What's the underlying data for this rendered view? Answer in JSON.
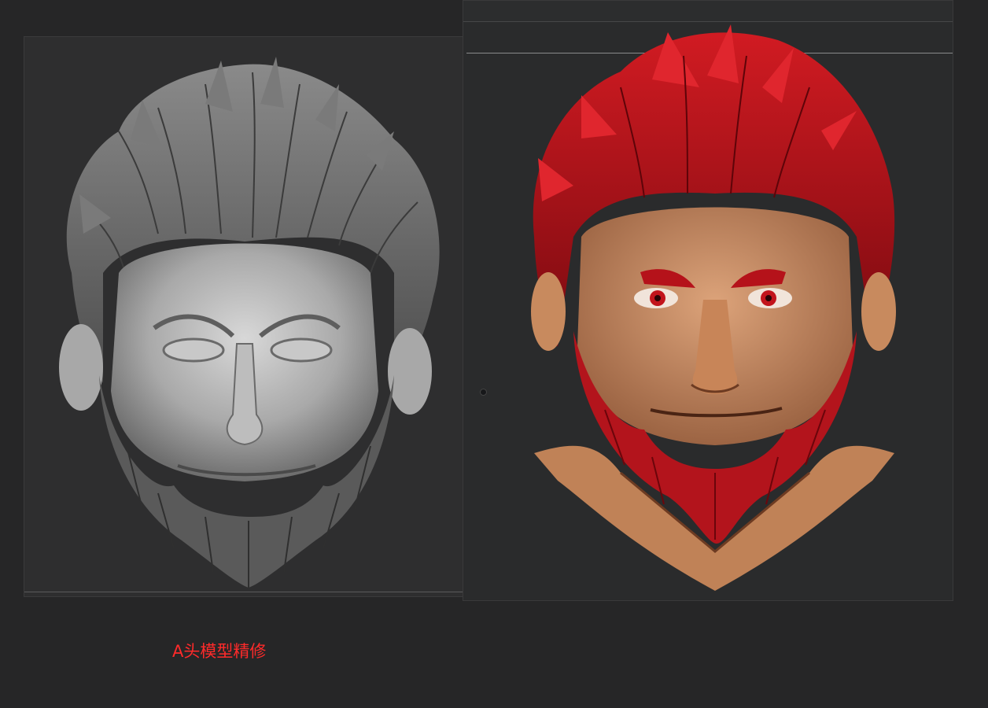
{
  "caption": "A头模型精修",
  "colors": {
    "background": "#262627",
    "caption": "#ff2a2a",
    "sculpt_gray": "#8d8d8d",
    "hair_red": "#b3141c",
    "skin": "#c98f66"
  },
  "images": {
    "left": "gray-clay-sculpt-head",
    "right": "painted-red-haired-bearded-head"
  }
}
